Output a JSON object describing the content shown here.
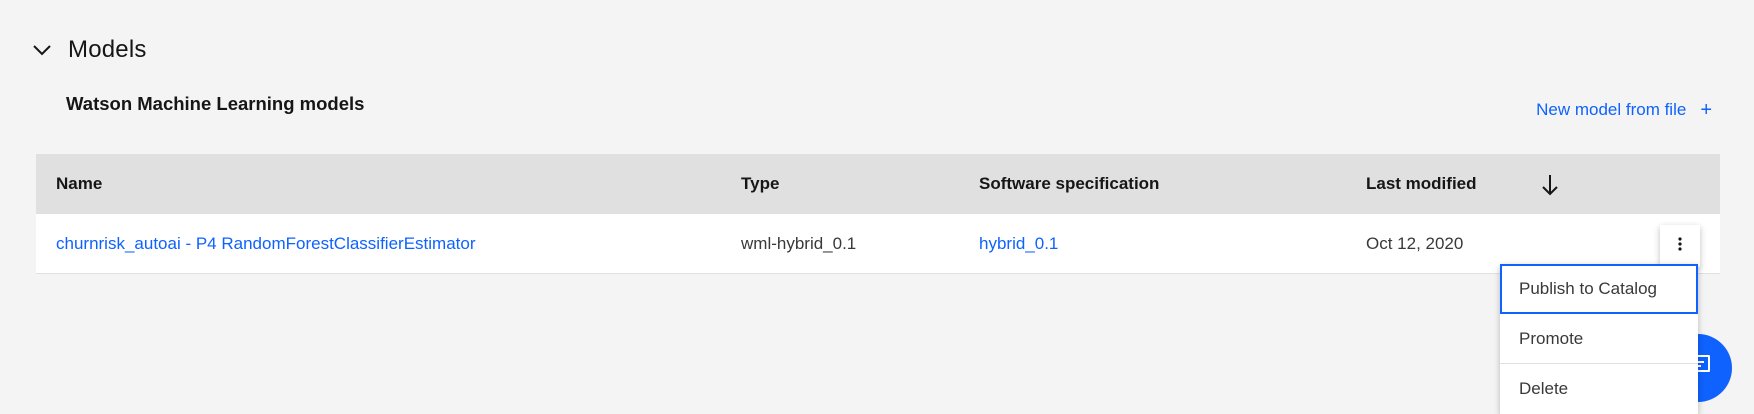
{
  "section": {
    "title": "Models",
    "expanded_icon": "chevron-down-icon"
  },
  "subheader": {
    "title": "Watson Machine Learning models"
  },
  "actions": {
    "new_model_label": "New model from file",
    "new_model_icon": "+"
  },
  "table": {
    "columns": [
      "Name",
      "Type",
      "Software specification",
      "Last modified"
    ],
    "sort_icon": "arrow-down-icon",
    "rows": [
      {
        "name": "churnrisk_autoai - P4 RandomForestClassifierEstimator",
        "type": "wml-hybrid_0.1",
        "software_spec": "hybrid_0.1",
        "last_modified": "Oct 12, 2020"
      }
    ]
  },
  "overflow_menu": {
    "icon": "overflow-menu-vertical-icon",
    "items": [
      "Publish to Catalog",
      "Promote",
      "Delete"
    ],
    "focused_index": 0
  },
  "colors": {
    "accent": "#0f62fe",
    "background": "#f4f4f4",
    "table_header": "#e0e0e0"
  }
}
